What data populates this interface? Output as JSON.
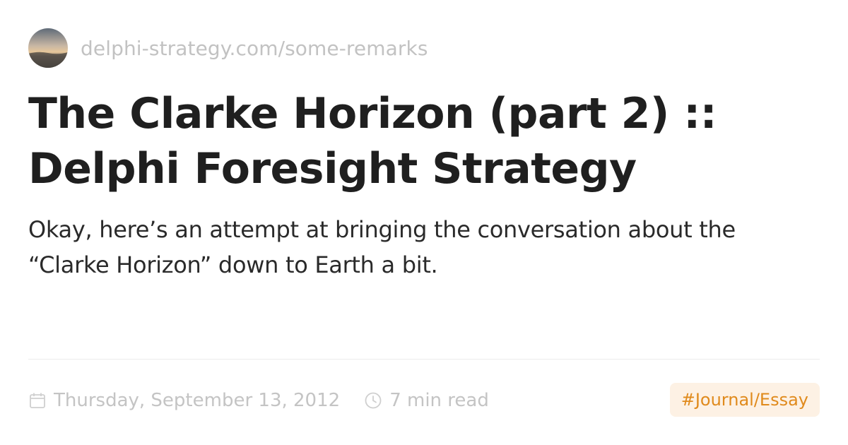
{
  "site": {
    "avatar_icon": "sunset-landscape-avatar",
    "url": "delphi-strategy.com/some-remarks"
  },
  "article": {
    "title_line1": "The Clarke Horizon (part 2) ::",
    "title_line2": "Delphi Foresight Strategy",
    "description_line1": "Okay, here’s an attempt at bringing the conversation about the",
    "description_line2": "“Clarke Horizon” down to Earth a bit."
  },
  "meta": {
    "date_icon": "calendar-icon",
    "date": "Thursday, September 13, 2012",
    "read_icon": "clock-icon",
    "read_time": "7 min read"
  },
  "tag": {
    "label": "#Journal/Essay"
  },
  "colors": {
    "title": "#1f1f1f",
    "text": "#2a2a2a",
    "muted": "#c2c2c2",
    "accent": "#e08a1c",
    "accent_bg": "#fdf1e4"
  }
}
